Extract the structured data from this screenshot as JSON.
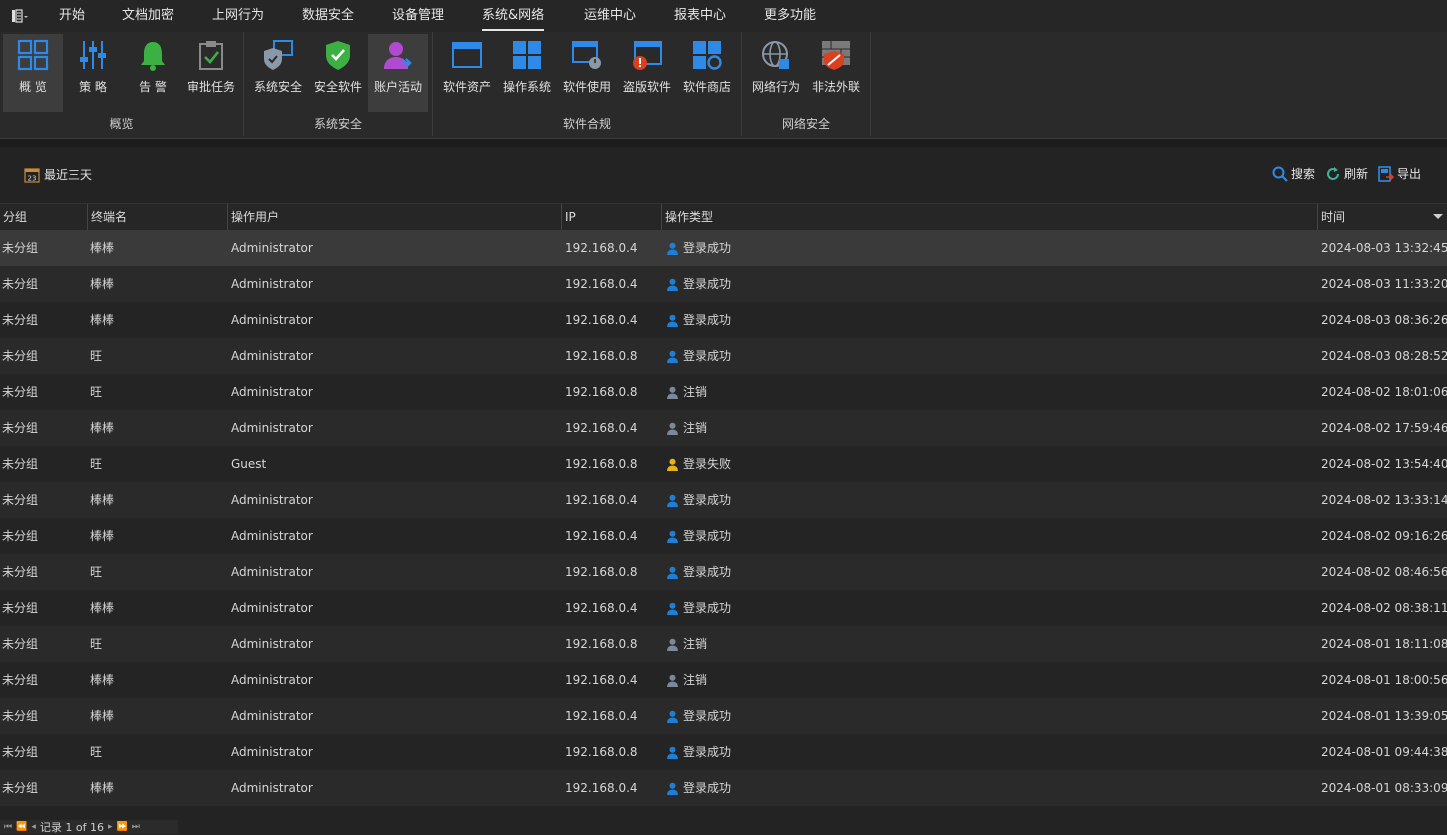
{
  "menu": {
    "tabs": [
      "开始",
      "文档加密",
      "上网行为",
      "数据安全",
      "设备管理",
      "系统&网络",
      "运维中心",
      "报表中心",
      "更多功能"
    ],
    "active": "系统&网络"
  },
  "ribbon": {
    "groups": {
      "overview": {
        "label": "概览",
        "buttons": {
          "overview": "概 览",
          "policy": "策 略",
          "alert": "告 警",
          "approval": "审批任务"
        }
      },
      "system_security": {
        "label": "系统安全",
        "buttons": {
          "system_security": "系统安全",
          "security_software": "安全软件",
          "account_activity": "账户活动"
        }
      },
      "software": {
        "label": "软件合规",
        "buttons": {
          "software_assets": "软件资产",
          "os": "操作系统",
          "software_usage": "软件使用",
          "pirated": "盗版软件",
          "store": "软件商店"
        }
      },
      "network": {
        "label": "网络安全",
        "buttons": {
          "network_behavior": "网络行为",
          "illegal_outreach": "非法外联"
        }
      }
    },
    "selected": "账户活动"
  },
  "toolbar": {
    "date_filter": "最近三天",
    "calendar_day": "23",
    "search": "搜索",
    "refresh": "刷新",
    "export": "导出"
  },
  "table": {
    "columns": {
      "group": "分组",
      "terminal": "终端名",
      "user": "操作用户",
      "ip": "IP",
      "op": "操作类型",
      "time": "时间"
    },
    "rows": [
      {
        "group": "未分组",
        "terminal": "棒棒",
        "user": "Administrator",
        "ip": "192.168.0.4",
        "op": "登录成功",
        "kind": "success",
        "time": "2024-08-03 13:32:45"
      },
      {
        "group": "未分组",
        "terminal": "棒棒",
        "user": "Administrator",
        "ip": "192.168.0.4",
        "op": "登录成功",
        "kind": "success",
        "time": "2024-08-03 11:33:20"
      },
      {
        "group": "未分组",
        "terminal": "棒棒",
        "user": "Administrator",
        "ip": "192.168.0.4",
        "op": "登录成功",
        "kind": "success",
        "time": "2024-08-03 08:36:26"
      },
      {
        "group": "未分组",
        "terminal": "旺",
        "user": "Administrator",
        "ip": "192.168.0.8",
        "op": "登录成功",
        "kind": "success",
        "time": "2024-08-03 08:28:52"
      },
      {
        "group": "未分组",
        "terminal": "旺",
        "user": "Administrator",
        "ip": "192.168.0.8",
        "op": "注销",
        "kind": "logout",
        "time": "2024-08-02 18:01:06"
      },
      {
        "group": "未分组",
        "terminal": "棒棒",
        "user": "Administrator",
        "ip": "192.168.0.4",
        "op": "注销",
        "kind": "logout",
        "time": "2024-08-02 17:59:46"
      },
      {
        "group": "未分组",
        "terminal": "旺",
        "user": "Guest",
        "ip": "192.168.0.8",
        "op": "登录失败",
        "kind": "fail",
        "time": "2024-08-02 13:54:40"
      },
      {
        "group": "未分组",
        "terminal": "棒棒",
        "user": "Administrator",
        "ip": "192.168.0.4",
        "op": "登录成功",
        "kind": "success",
        "time": "2024-08-02 13:33:14"
      },
      {
        "group": "未分组",
        "terminal": "棒棒",
        "user": "Administrator",
        "ip": "192.168.0.4",
        "op": "登录成功",
        "kind": "success",
        "time": "2024-08-02 09:16:26"
      },
      {
        "group": "未分组",
        "terminal": "旺",
        "user": "Administrator",
        "ip": "192.168.0.8",
        "op": "登录成功",
        "kind": "success",
        "time": "2024-08-02 08:46:56"
      },
      {
        "group": "未分组",
        "terminal": "棒棒",
        "user": "Administrator",
        "ip": "192.168.0.4",
        "op": "登录成功",
        "kind": "success",
        "time": "2024-08-02 08:38:11"
      },
      {
        "group": "未分组",
        "terminal": "旺",
        "user": "Administrator",
        "ip": "192.168.0.8",
        "op": "注销",
        "kind": "logout",
        "time": "2024-08-01 18:11:08"
      },
      {
        "group": "未分组",
        "terminal": "棒棒",
        "user": "Administrator",
        "ip": "192.168.0.4",
        "op": "注销",
        "kind": "logout",
        "time": "2024-08-01 18:00:56"
      },
      {
        "group": "未分组",
        "terminal": "棒棒",
        "user": "Administrator",
        "ip": "192.168.0.4",
        "op": "登录成功",
        "kind": "success",
        "time": "2024-08-01 13:39:05"
      },
      {
        "group": "未分组",
        "terminal": "旺",
        "user": "Administrator",
        "ip": "192.168.0.8",
        "op": "登录成功",
        "kind": "success",
        "time": "2024-08-01 09:44:38"
      },
      {
        "group": "未分组",
        "terminal": "棒棒",
        "user": "Administrator",
        "ip": "192.168.0.4",
        "op": "登录成功",
        "kind": "success",
        "time": "2024-08-01 08:33:09"
      }
    ]
  },
  "pager": {
    "text": "记录 1 of 16"
  },
  "colors": {
    "success": "#1e7fd8",
    "logout": "#7a8a9a",
    "fail": "#e8b21a",
    "accent_blue": "#2e8ae6",
    "shield_green": "#3cb043",
    "account_purple": "#b04ad0"
  }
}
